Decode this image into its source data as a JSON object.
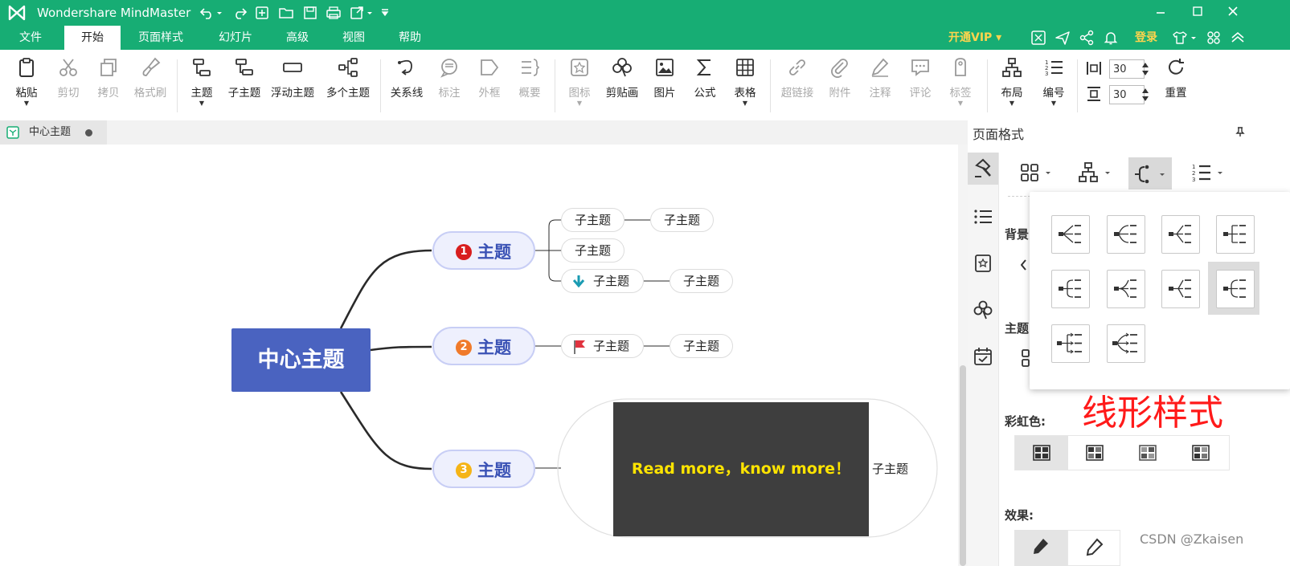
{
  "app": {
    "title": "Wondershare MindMaster"
  },
  "menu": {
    "items": [
      "文件",
      "开始",
      "页面样式",
      "幻灯片",
      "高级",
      "视图",
      "帮助"
    ],
    "active": "开始",
    "vip": "开通VIP",
    "login": "登录"
  },
  "ribbon": {
    "paste": "粘贴",
    "cut": "剪切",
    "copy": "拷贝",
    "format_painter": "格式刷",
    "topic": "主题",
    "subtopic": "子主题",
    "floating": "浮动主题",
    "multi": "多个主题",
    "relation": "关系线",
    "callout": "标注",
    "boundary": "外框",
    "summary": "概要",
    "icon": "图标",
    "clipart": "剪贴画",
    "picture": "图片",
    "formula": "公式",
    "table": "表格",
    "hyperlink": "超链接",
    "attachment": "附件",
    "note": "注释",
    "comment": "评论",
    "tag": "标签",
    "layout": "布局",
    "numbering": "编号",
    "spacing_h": "30",
    "spacing_v": "30",
    "reset": "重置"
  },
  "doc_tab": {
    "label": "中心主题"
  },
  "canvas": {
    "central": "中心主题",
    "main_topics": [
      {
        "number": "1",
        "label": "主题",
        "color": "#d81e1e"
      },
      {
        "number": "2",
        "label": "主题",
        "color": "#f07a2a"
      },
      {
        "number": "3",
        "label": "主题",
        "color": "#f5b416"
      }
    ],
    "sub_label": "子主题",
    "image_text": "Read more，know more！",
    "image_caption": "子主题"
  },
  "panel": {
    "title": "页面格式",
    "background_label": "背景",
    "theme_label": "主题",
    "rainbow_label": "彩虹色:",
    "effect_label": "效果:"
  },
  "overlay_note": "线形样式",
  "watermark": "CSDN @Zkaisen",
  "colors": {
    "brand": "#17ad74",
    "central": "#4a63c0",
    "vip": "#ffd44d"
  }
}
